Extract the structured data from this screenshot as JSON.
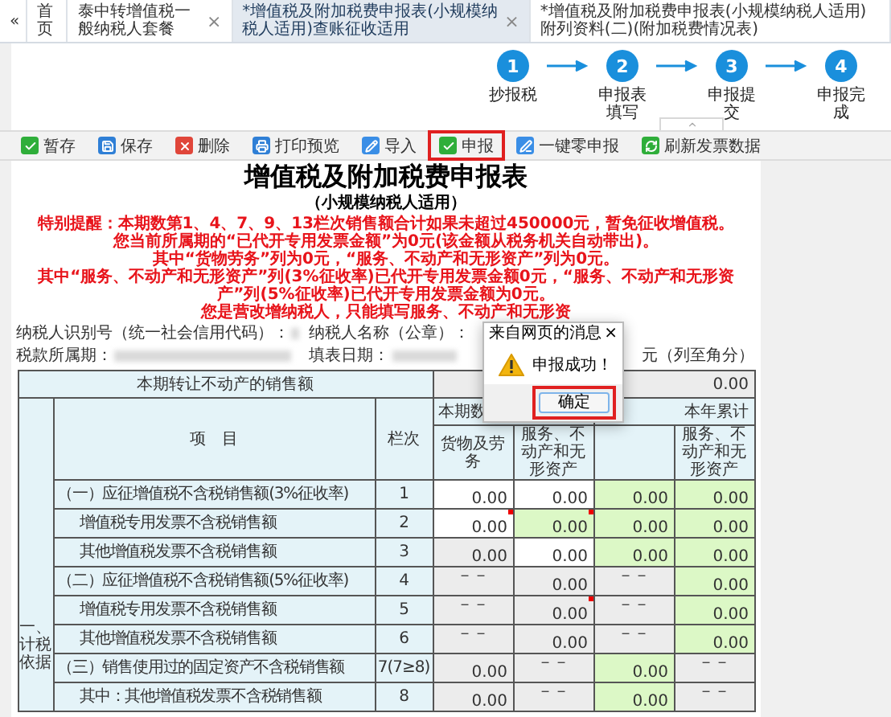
{
  "tabs": [
    {
      "label": "«",
      "selected": false
    },
    {
      "label": "首页",
      "selected": false
    },
    {
      "label": "泰中转增值税一般纳税人套餐",
      "selected": false,
      "close": "×"
    },
    {
      "label": "*增值税及附加税费申报表(小规模纳税人适用)查账征收适用",
      "selected": true,
      "close": "×"
    },
    {
      "label": "*增值税及附加税费申报表(小规模纳税人适用)附列资料(二)(附加税费情况表)",
      "selected": false
    }
  ],
  "steps": [
    {
      "number": "1",
      "label": "抄报税"
    },
    {
      "number": "2",
      "label": "申报表填写"
    },
    {
      "number": "3",
      "label": "申报提交"
    },
    {
      "number": "4",
      "label": "申报完成"
    }
  ],
  "toolbar": [
    {
      "kind": "stage",
      "label": "暂存",
      "highlighted": false
    },
    {
      "kind": "save",
      "label": "保存",
      "highlighted": false
    },
    {
      "kind": "delete",
      "label": "删除",
      "highlighted": false
    },
    {
      "kind": "print",
      "label": "打印预览",
      "highlighted": false
    },
    {
      "kind": "import",
      "label": "导入",
      "highlighted": false
    },
    {
      "kind": "submit",
      "label": "申报",
      "highlighted": true
    },
    {
      "kind": "zero",
      "label": "一键零申报",
      "highlighted": false
    },
    {
      "kind": "refresh",
      "label": "刷新发票数据",
      "highlighted": false
    }
  ],
  "form": {
    "title": "增值税及附加税费申报表",
    "subtitle": "（小规模纳税人适用）",
    "notices": [
      "特别提醒：本期数第1、4、7、9、13栏次销售额合计如果未超过450000元，暂免征收增值税。",
      "您当前所属期的“已代开专用发票金额”为0元(该金额从税务机关自动带出)。",
      "其中“货物劳务”列为0元，“服务、不动产和无形资产”列为0元。",
      "其中“服务、不动产和无形资产”列(3%征收率)已代开专用发票金额0元，“服务、不动产和无形资产”列(5%征收率)已代开专用发票金额为0元。",
      "您是营改增纳税人，只能填写服务、不动产和无形资"
    ],
    "info": [
      [
        "纳税人识别号（统一社会信用代码）：",
        "纳税人名称（公章）："
      ],
      [
        "税款所属期：",
        "填表日期："
      ]
    ],
    "unit": "元（列至角分）",
    "transfer_row": {
      "label": "本期转让不动产的销售额",
      "value": "0.00"
    },
    "section": "一、计税依据",
    "item_header": "项　目",
    "line_header": "栏次",
    "column_groups": [
      {
        "label": "本期数",
        "columns": [
          "货物及劳务",
          "服务、不动产和无形资产"
        ]
      },
      {
        "label": "本年累计",
        "columns": [
          "服务、不动产和无形资产"
        ]
      }
    ],
    "rows": [
      {
        "item": "（一）应征增值税不含税销售额(3%征收率)",
        "line": "1",
        "cells": [
          {
            "kind": "input",
            "value": "0.00",
            "flag": false
          },
          {
            "kind": "input",
            "value": "0.00",
            "flag": false
          },
          {
            "kind": "calc",
            "value": "0.00",
            "flag": false
          },
          {
            "kind": "calc",
            "value": "0.00",
            "flag": false
          }
        ],
        "children": [
          {
            "item": "增值税专用发票不含税销售额",
            "line": "2",
            "cells": [
              {
                "kind": "input",
                "value": "0.00",
                "flag": true
              },
              {
                "kind": "calc",
                "value": "0.00",
                "flag": true
              },
              {
                "kind": "calc",
                "value": "0.00",
                "flag": false
              },
              {
                "kind": "calc",
                "value": "0.00",
                "flag": false
              }
            ]
          },
          {
            "item": "其他增值税发票不含税销售额",
            "line": "3",
            "cells": [
              {
                "kind": "locked",
                "value": "0.00",
                "flag": false
              },
              {
                "kind": "input",
                "value": "0.00",
                "flag": false
              },
              {
                "kind": "calc",
                "value": "0.00",
                "flag": false
              },
              {
                "kind": "calc",
                "value": "0.00",
                "flag": false
              }
            ]
          }
        ]
      },
      {
        "item": "（二）应征增值税不含税销售额(5%征收率)",
        "line": "4",
        "cells": [
          {
            "kind": "na",
            "value": "－－",
            "flag": false
          },
          {
            "kind": "locked",
            "value": "0.00",
            "flag": false
          },
          {
            "kind": "na",
            "value": "－－",
            "flag": false
          },
          {
            "kind": "calc",
            "value": "0.00",
            "flag": false
          }
        ],
        "children": [
          {
            "item": "增值税专用发票不含税销售额",
            "line": "5",
            "cells": [
              {
                "kind": "na",
                "value": "－－",
                "flag": false
              },
              {
                "kind": "locked",
                "value": "0.00",
                "flag": true
              },
              {
                "kind": "na",
                "value": "－－",
                "flag": false
              },
              {
                "kind": "calc",
                "value": "0.00",
                "flag": false
              }
            ]
          },
          {
            "item": "其他增值税发票不含税销售额",
            "line": "6",
            "cells": [
              {
                "kind": "na",
                "value": "－－",
                "flag": false
              },
              {
                "kind": "locked",
                "value": "0.00",
                "flag": false
              },
              {
                "kind": "na",
                "value": "－－",
                "flag": false
              },
              {
                "kind": "calc",
                "value": "0.00",
                "flag": false
              }
            ]
          }
        ]
      },
      {
        "item": "（三）销售使用过的固定资产不含税销售额",
        "line": "7(7≥8)",
        "cells": [
          {
            "kind": "locked",
            "value": "0.00",
            "flag": false
          },
          {
            "kind": "na",
            "value": "－－",
            "flag": false
          },
          {
            "kind": "calc",
            "value": "0.00",
            "flag": false
          },
          {
            "kind": "na",
            "value": "－－",
            "flag": false
          }
        ],
        "children": [
          {
            "item": "其中：其他增值税发票不含税销售额",
            "line": "8",
            "cells": [
              {
                "kind": "locked",
                "value": "0.00",
                "flag": false
              },
              {
                "kind": "na",
                "value": "－－",
                "flag": false
              },
              {
                "kind": "calc",
                "value": "0.00",
                "flag": false
              },
              {
                "kind": "na",
                "value": "－－",
                "flag": false
              }
            ]
          }
        ]
      }
    ]
  },
  "dialog": {
    "title": "来自网页的消息",
    "close": "×",
    "message": "申报成功！",
    "button": {
      "label": "确定",
      "highlighted": true
    }
  }
}
